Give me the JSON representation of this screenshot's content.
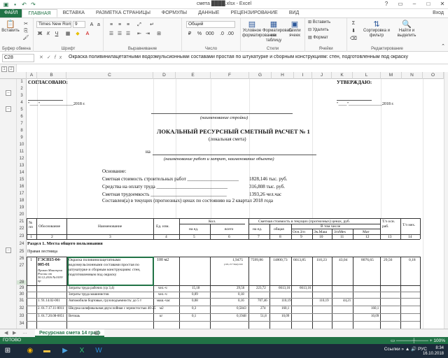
{
  "window": {
    "title": "смета ████.xlsx - Excel",
    "controls": [
      "?",
      "▭",
      "–",
      "□",
      "✕"
    ]
  },
  "qat": [
    "save-icon",
    "undo-icon",
    "redo-icon"
  ],
  "ribbon_tabs": [
    "ФАЙЛ",
    "ГЛАВНАЯ",
    "ВСТАВКА",
    "РАЗМЕТКА СТРАНИЦЫ",
    "ФОРМУЛЫ",
    "ДАННЫЕ",
    "РЕЦЕНЗИРОВАНИЕ",
    "ВИД"
  ],
  "account": "Вход",
  "ribbon": {
    "paste": "Вставить",
    "clipboard": "Буфер обмена",
    "font_name": "Times New Roma",
    "font_size": "9",
    "font_group": "Шрифт",
    "align_group": "Выравнивание",
    "number_format": "Общий",
    "number_group": "Число",
    "cond": "Условное форматирование",
    "fmt_table": "Форматировать как таблицу",
    "cell_styles": "Стили ячеек",
    "styles_group": "Стили",
    "insert": "Вставить",
    "delete": "Удалить",
    "format": "Формат",
    "cells_group": "Ячейки",
    "sort": "Сортировка и фильтр",
    "find": "Найти и выделить",
    "edit_group": "Редактирование"
  },
  "formula_bar": {
    "namebox": "C28",
    "formula": "Окраска поливинилацетатными водоэмульсионными составами простая по штукатурке и сборным конструкциям: стен, подготовленным под окраску"
  },
  "columns": [
    "A",
    "B",
    "C",
    "D",
    "E",
    "F",
    "G",
    "H",
    "I",
    "J",
    "K",
    "L",
    "M",
    "N",
    "O"
  ],
  "rows": [
    "1",
    "2",
    "3",
    "4",
    "5",
    "6",
    "7",
    "8",
    "9",
    "10",
    "11",
    "12",
    "13",
    "14",
    "15",
    "16",
    "17",
    "18",
    "19",
    "20",
    "21",
    "22",
    "23",
    "24",
    "25",
    "26",
    "27",
    "28",
    "29",
    "30",
    "31",
    "32",
    "33",
    "34"
  ],
  "doc": {
    "agreed": "СОГЛАСОВАНО:",
    "approved": "УТВЕРЖДАЮ:",
    "date_left": "\"____\"________________2018 г.",
    "date_right": "\"____\"________________2018 г.",
    "construction_caption": "(наименование стройки)",
    "doc_title": "ЛОКАЛЬНЫЙ РЕСУРСНЫЙ СМЕТНЫЙ РАСЧЕТ  № 1",
    "doc_subtitle": "(локальная смета)",
    "na": "на",
    "works_caption": "(наименование работ и затрат, наименование объекта)",
    "basis": "Основание:",
    "cost_label": "Сметная стоимость строительных работ _____________________",
    "cost_value": "1828,146 тыс. руб.",
    "wage_label": "Средства на оплату труда _____________________________",
    "wage_value": "316,808 тыс. руб.",
    "labor_label": "Сметная трудоемкость _______________________________",
    "labor_value": "1393,26 чел.час",
    "prices_line": "Составлен(а) в текущих (прогнозных) ценах по состоянию на 2 квартал 2018 года"
  },
  "table_head": {
    "num": "№ пп",
    "basis": "Обоснование",
    "name": "Наименование",
    "unit": "Ед. изм.",
    "qty": "Кол.",
    "qty_unit": "на ед.",
    "qty_total": "всего",
    "cost": "Сметная стоимость в текущих (прогнозных) ценах, руб.",
    "cost_unit": "на ед.",
    "cost_total": "общая",
    "incl": "В том числе",
    "wage": "Осн.З/п",
    "mach": "Эк.Маш",
    "mach_wage": "З/пМех",
    "mat": "Мат",
    "t_wrk": "Т/з осн. раб.",
    "t_mach": "Т/з мех.",
    "col_numbers": [
      "1",
      "2",
      "3",
      "4",
      "5",
      "6",
      "7",
      "8",
      "9",
      "10",
      "11",
      "12",
      "13",
      "14"
    ]
  },
  "section": "Раздел 1. Места общего пользования",
  "subsection": "Правая лестница",
  "item1": {
    "num": "1",
    "code": "ГЭСН15-04-005-01",
    "note": "Приказ Минстроя России от 30.12.2016 №1039/пр",
    "name": "Окраска поливинилацетатными водоэмульсионными составами простая по штукатурке и сборным конструкциям: стен, подготовленным под окраску",
    "unit": "100 м2",
    "qty_total": "1,9475",
    "qty_formula": "(105,15+58,8)/100",
    "cost_unit": "7599,86",
    "cost_total": "14800,73",
    "wage": "6613,85",
    "mach": "110,23",
    "mach_wage": "43,04",
    "mat": "8076,65",
    "t_wrk": "29,56",
    "t_mach": "0,18"
  },
  "rows_detail": [
    {
      "basis": "",
      "name": "Затраты труда рабочих (ср 3,4)",
      "unit": "чел.-ч",
      "qty_unit": "15,18",
      "qty_total": "29,56",
      "cost_unit": "223,72",
      "cost_total": "6613,16",
      "wage": "6613,16",
      "mach": "",
      "mach_wage": "",
      "mat": ""
    },
    {
      "basis": "",
      "name": "Затраты труда машинистов",
      "unit": "чел.-ч",
      "qty_unit": "0,09",
      "qty_total": "0,18",
      "cost_unit": "",
      "cost_total": "",
      "wage": "",
      "mach": "",
      "mach_wage": "",
      "mat": ""
    },
    {
      "basis": "1. 91.14.02-001",
      "name": "Автомобили бортовые, грузоподъемность: до 5 т",
      "unit": "маш.-час",
      "qty_unit": "0,08",
      "qty_total": "0,16",
      "cost_unit": "707,46",
      "cost_total": "110,19",
      "wage": "",
      "mach": "110,19",
      "mach_wage": "44,21",
      "mat": ""
    },
    {
      "basis": "2. 01.7.17.11-0011",
      "name": "Шкурка шлифовальная двухслойная с зернистостью 40-25",
      "unit": "м2",
      "qty_unit": "0,3",
      "qty_total": "0,5843",
      "cost_unit": "274",
      "cost_total": "160,1",
      "wage": "",
      "mach": "",
      "mach_wage": "",
      "mat": "160,1"
    },
    {
      "basis": "3. 01.7.20.08-0051",
      "name": "Ветошь",
      "unit": "кг",
      "qty_unit": "0,1",
      "qty_total": "0,1948",
      "cost_unit": "51,8",
      "cost_total": "10,09",
      "wage": "",
      "mach": "",
      "mach_wage": "",
      "mat": "10,09"
    }
  ],
  "sheet_tab": "Ресурсная смета 14 граф",
  "status": {
    "ready": "ГОТОВО",
    "zoom": "▭  ─────┼──── +  100%"
  },
  "taskbar": {
    "tray": "Ссылки  »  ▲  🔊  РУС",
    "time": "8:34",
    "date": "16.10.2018"
  }
}
